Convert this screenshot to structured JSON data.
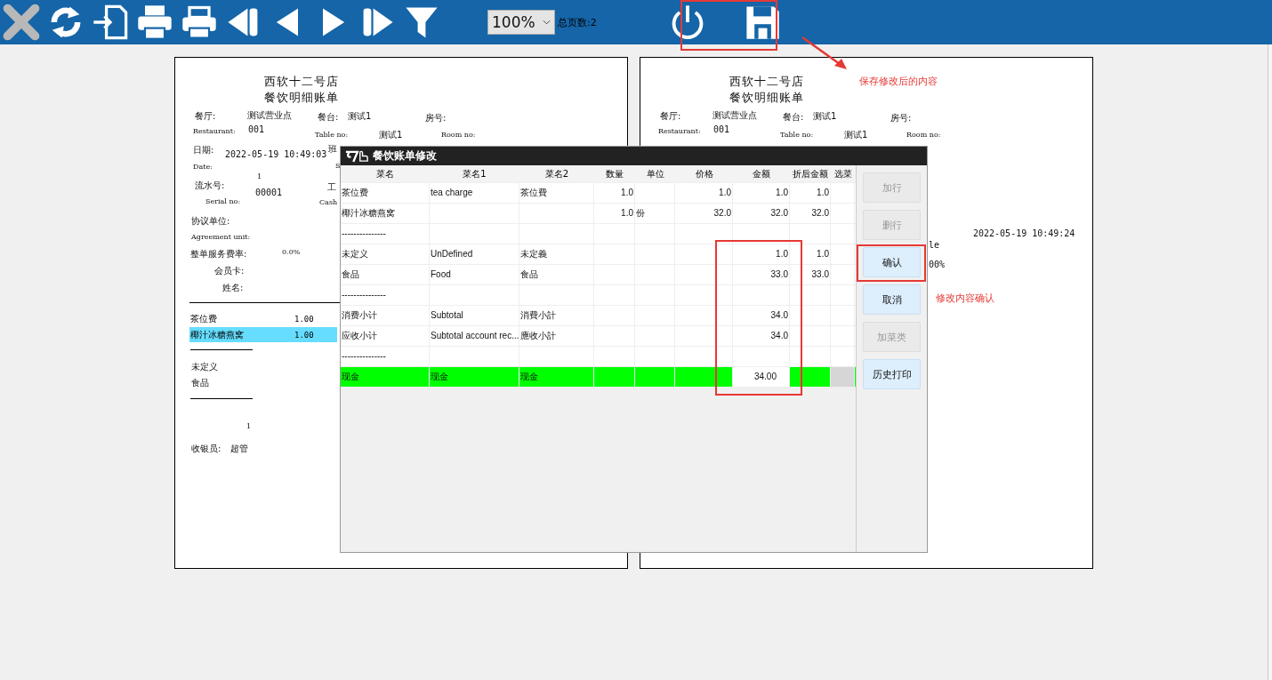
{
  "toolbar": {
    "zoom": "100%",
    "page_count": "总页数:2"
  },
  "receipts": [
    {
      "title": "西软十二号店",
      "subtitle": "餐饮明细账单",
      "restaurant_label": "餐厅:",
      "restaurant": "测试营业点",
      "table_label": "餐台:",
      "table": "测试1",
      "room_label": "房号:",
      "restaurant_en": "Restaurant:",
      "restaurant_no": "001",
      "table_en": "Table no:",
      "table_no": "测试1",
      "room_en": "Room no:",
      "details": {
        "date_label": "日期:",
        "date": "2022-05-19 10:49:03",
        "shift_label": "班",
        "date_en": "Date:",
        "shift_en": "S",
        "serial_label": "流水号:",
        "serial_count": "1",
        "serial": "00001",
        "serial_en": "Serial no:",
        "staff_label": "工",
        "cashier_en": "Cash",
        "agreement_label": "协议单位:",
        "agreement_en": "Agreement unit:",
        "service_rate_label": "整单服务费率:",
        "service_rate": "0.0%",
        "member_label": "会员卡:",
        "name_label": "姓名:",
        "items": [
          {
            "name": "茶位费",
            "qty": "1.00",
            "selected": false
          },
          {
            "name": "椰汁冰糖燕窝",
            "qty": "1.00",
            "selected": true
          }
        ],
        "categories": [
          "未定义",
          "食品"
        ],
        "total_count": "1",
        "cashier_label": "收银员:",
        "cashier": "超管"
      }
    },
    {
      "title": "西软十二号店",
      "subtitle": "餐饮明细账单",
      "restaurant_label": "餐厅:",
      "restaurant": "测试营业点",
      "table_label": "餐台:",
      "table": "测试1",
      "room_label": "房号:",
      "restaurant_en": "Restaurant:",
      "restaurant_no": "001",
      "table_en": "Table no:",
      "table_no": "测试1",
      "room_en": "Room no:",
      "fragments": {
        "time": "2022-05-19 10:49:24",
        "label_end": "le",
        "rate_end": "00%"
      }
    }
  ],
  "dialog": {
    "title": "餐饮账单修改",
    "columns": [
      "菜名",
      "菜名1",
      "菜名2",
      "数量",
      "单位",
      "价格",
      "金额",
      "折后金额",
      "选菜"
    ],
    "rows": [
      {
        "cells": [
          "茶位费",
          "tea charge",
          "茶位費",
          "1.0",
          "",
          "1.0",
          "1.0",
          "1.0",
          ""
        ],
        "selected": false
      },
      {
        "cells": [
          "椰汁冰糖燕窝",
          "",
          "",
          "1.0",
          "份",
          "32.0",
          "32.0",
          "32.0",
          ""
        ],
        "selected": false
      },
      {
        "cells": [
          "---------------",
          "",
          "",
          "",
          "",
          "",
          "",
          "",
          ""
        ],
        "selected": false
      },
      {
        "cells": [
          "未定义",
          "UnDefined",
          "未定義",
          "",
          "",
          "",
          "1.0",
          "1.0",
          ""
        ],
        "selected": false
      },
      {
        "cells": [
          "食品",
          "Food",
          "食品",
          "",
          "",
          "",
          "33.0",
          "33.0",
          ""
        ],
        "selected": false
      },
      {
        "cells": [
          "---------------",
          "",
          "",
          "",
          "",
          "",
          "",
          "",
          ""
        ],
        "selected": false
      },
      {
        "cells": [
          "消费小计",
          "Subtotal",
          "消費小計",
          "",
          "",
          "",
          "34.0",
          "",
          ""
        ],
        "selected": false
      },
      {
        "cells": [
          "应收小计",
          "Subtotal account rec...",
          "應收小計",
          "",
          "",
          "",
          "34.0",
          "",
          ""
        ],
        "selected": false
      },
      {
        "cells": [
          "---------------",
          "",
          "",
          "",
          "",
          "",
          "",
          "",
          ""
        ],
        "selected": false
      },
      {
        "cells": [
          "现金",
          "现金",
          "现金",
          "",
          "",
          "",
          "",
          "",
          ""
        ],
        "selected": true,
        "amount_field": {
          "value": "34.00"
        }
      }
    ],
    "buttons": [
      {
        "label": "加行",
        "disabled": true
      },
      {
        "label": "删行",
        "disabled": true
      },
      {
        "label": "确认",
        "disabled": false
      },
      {
        "label": "取消",
        "disabled": false
      },
      {
        "label": "加菜类",
        "disabled": true
      },
      {
        "label": "历史打印",
        "disabled": false
      }
    ]
  },
  "annotations": [
    {
      "text": "保存修改后的内容"
    },
    {
      "text": "修改内容确认"
    }
  ]
}
